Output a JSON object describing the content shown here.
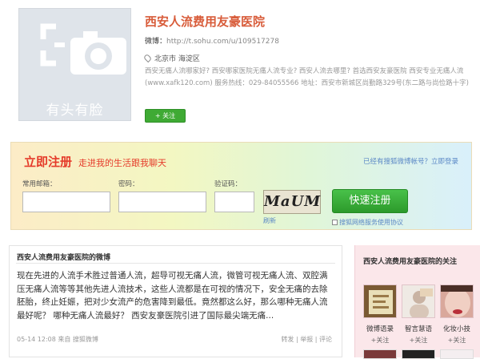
{
  "profile": {
    "avatar_caption": "有头有脸",
    "name": "西安人流费用友豪医院",
    "weibo_label": "微博：",
    "weibo_url": "http://t.sohu.com/u/109517278",
    "location": "北京市 海淀区",
    "description": "西安无痛人流哪家好? 西安哪家医院无痛人流专业? 西安人流去哪里? 首选西安友豪医院 西安专业无痛人流(www.xafk120.com) 服务热线：029-84055566 地址：西安市新城区尚勤路329号(东二路与尚俭路十字)",
    "follow_label": "+ 关注"
  },
  "register": {
    "title": "立即注册",
    "subtitle": "走进我的生活跟我聊天",
    "login_prompt": "已经有搜狐微博帐号？立即登录",
    "email_label": "常用邮箱：",
    "password_label": "密码：",
    "code_label": "验证码：",
    "captcha_text": "MaUM",
    "refresh_label": "刷新",
    "submit_label": "快速注册",
    "agreement_label": "搜狐网络服务使用协议"
  },
  "feed": {
    "title": "西安人流费用友豪医院的微博",
    "post_text": "现在先进的人流手术胜过普通人流，超导可视无痛人流，微管可视无痛人流、双腔满压无痛人流等等其他先进人流技术，这些人流都是在可视的情况下，安全无痛的去除胚胎，终止妊娠，把对少女流产的危害降到最低。竟然都这么好，那么哪种无痛人流最好呢？ 哪种无痛人流最好？ 西安友豪医院引进了国际最尖端无痛...",
    "timestamp": "05-14 12:08",
    "source": "来自 搜狐微博",
    "actions": "转发 | 举报 | 评论"
  },
  "panel": {
    "title": "西安人流费用友豪医院的关注",
    "items": [
      {
        "label": "微博语录",
        "follow": "+关注"
      },
      {
        "label": "智言慧语",
        "follow": "+关注"
      },
      {
        "label": "化妆小技",
        "follow": "+关注"
      }
    ]
  }
}
